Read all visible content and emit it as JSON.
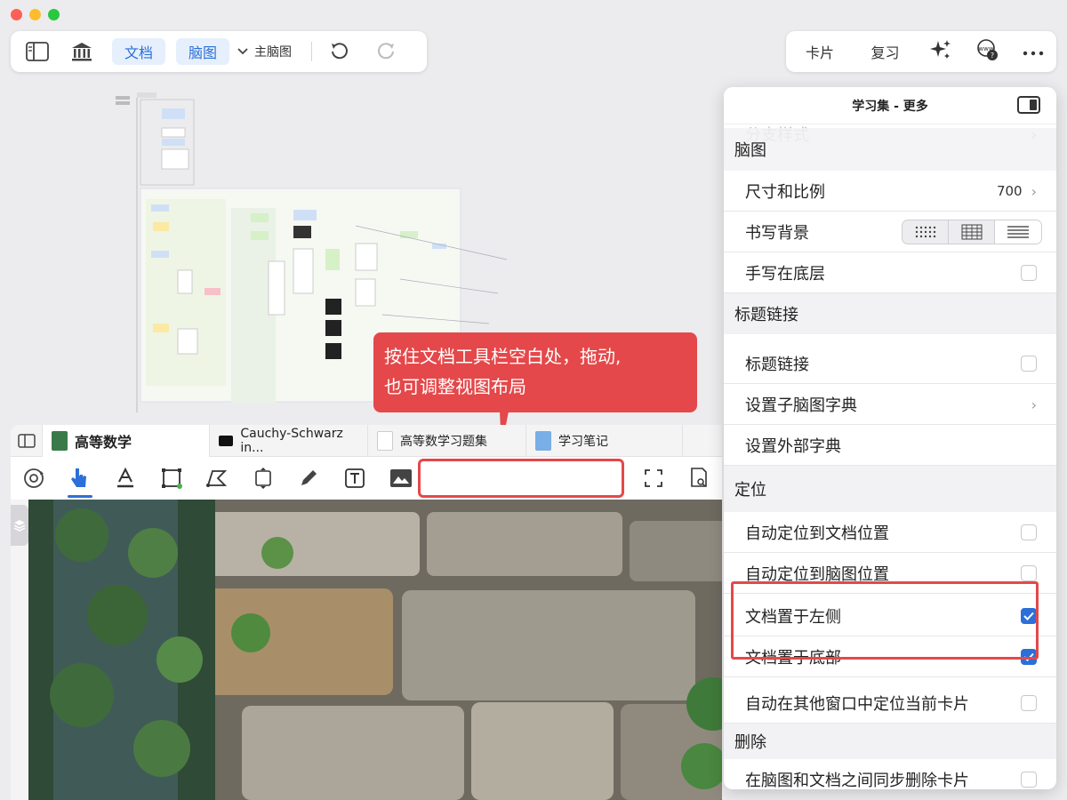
{
  "window": {
    "traffic_colors": [
      "#fe5f57",
      "#febc2e",
      "#28c840"
    ]
  },
  "toolbar_left": {
    "doc_label": "文档",
    "mindmap_label": "脑图",
    "main_map_label": "主脑图",
    "icons": [
      "sidebar-icon",
      "library-icon",
      "chevron-down-icon",
      "undo-icon",
      "redo-icon"
    ]
  },
  "toolbar_right": {
    "card_label": "卡片",
    "review_label": "复习",
    "icons": [
      "sparkle-icon",
      "www-help-icon",
      "more-icon"
    ]
  },
  "callout": {
    "line1": "按住文档工具栏空白处，拖动,",
    "line2": "也可调整视图布局"
  },
  "doc_tabs": [
    {
      "label": "高等数学",
      "active": true
    },
    {
      "label": "Cauchy-Schwarz in...",
      "active": false
    },
    {
      "label": "高等数学习题集",
      "active": false
    },
    {
      "label": "学习笔记",
      "active": false
    }
  ],
  "doc_toolbar_icons": [
    "rotate-settings-icon",
    "hand-pointer-icon",
    "text-underline-icon",
    "select-rect-icon",
    "lasso-icon",
    "resize-icon",
    "pen-icon",
    "textbox-icon",
    "image-icon",
    "fullscreen-icon",
    "search-doc-icon"
  ],
  "panel": {
    "title": "学习集 - 更多",
    "partial_row": "分支样式",
    "section_mindmap": "脑图",
    "size_label": "尺寸和比例",
    "size_value": "700",
    "bg_label": "书写背景",
    "handwrite_label": "手写在底层",
    "section_title_link": "标题链接",
    "title_link_label": "标题链接",
    "sub_dict_label": "设置子脑图字典",
    "ext_dict_label": "设置外部字典",
    "section_locate": "定位",
    "auto_doc_label": "自动定位到文档位置",
    "auto_map_label": "自动定位到脑图位置",
    "doc_left_label": "文档置于左侧",
    "doc_bottom_label": "文档置于底部",
    "auto_other_label": "自动在其他窗口中定位当前卡片",
    "section_delete": "删除",
    "sync_delete_label": "在脑图和文档之间同步删除卡片",
    "checkboxes": {
      "handwrite": false,
      "title_link": false,
      "auto_doc": false,
      "auto_map": false,
      "doc_left": true,
      "doc_bottom": true,
      "auto_other": false,
      "sync_delete": false
    }
  },
  "colors": {
    "accent": "#2c6fd8",
    "highlight": "#e4484a"
  }
}
